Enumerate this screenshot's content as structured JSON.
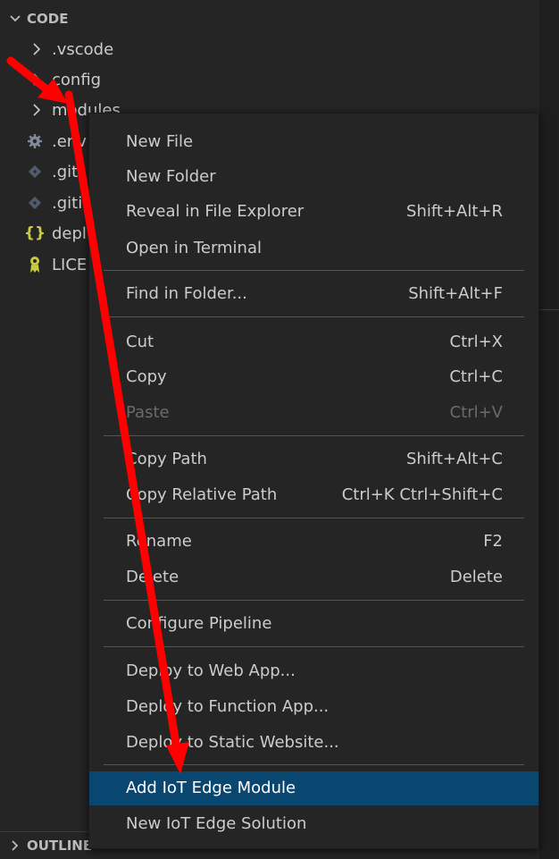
{
  "explorer": {
    "section_title": "CODE",
    "items": [
      {
        "label": ".vscode",
        "icon": "chevron-right-icon"
      },
      {
        "label": "config",
        "icon": "chevron-right-icon"
      },
      {
        "label": "modules",
        "icon": "chevron-right-icon"
      },
      {
        "label": ".env",
        "icon": "gear-icon"
      },
      {
        "label": ".giti",
        "icon": "git-icon"
      },
      {
        "label": ".giti",
        "icon": "git-icon"
      },
      {
        "label": "depl",
        "icon": "json-braces-icon"
      },
      {
        "label": "LICE",
        "icon": "license-icon"
      }
    ],
    "outline_title": "OUTLINE"
  },
  "context_menu": {
    "groups": [
      [
        {
          "label": "New File",
          "shortcut": ""
        },
        {
          "label": "New Folder",
          "shortcut": ""
        },
        {
          "label": "Reveal in File Explorer",
          "shortcut": "Shift+Alt+R"
        },
        {
          "label": "Open in Terminal",
          "shortcut": ""
        }
      ],
      [
        {
          "label": "Find in Folder...",
          "shortcut": "Shift+Alt+F"
        }
      ],
      [
        {
          "label": "Cut",
          "shortcut": "Ctrl+X"
        },
        {
          "label": "Copy",
          "shortcut": "Ctrl+C"
        },
        {
          "label": "Paste",
          "shortcut": "Ctrl+V",
          "disabled": true
        }
      ],
      [
        {
          "label": "Copy Path",
          "shortcut": "Shift+Alt+C"
        },
        {
          "label": "Copy Relative Path",
          "shortcut": "Ctrl+K Ctrl+Shift+C"
        }
      ],
      [
        {
          "label": "Rename",
          "shortcut": "F2"
        },
        {
          "label": "Delete",
          "shortcut": "Delete"
        }
      ],
      [
        {
          "label": "Configure Pipeline",
          "shortcut": ""
        }
      ],
      [
        {
          "label": "Deploy to Web App...",
          "shortcut": ""
        },
        {
          "label": "Deploy to Function App...",
          "shortcut": ""
        },
        {
          "label": "Deploy to Static Website...",
          "shortcut": ""
        }
      ],
      [
        {
          "label": "Add IoT Edge Module",
          "shortcut": "",
          "selected": true
        },
        {
          "label": "New IoT Edge Solution",
          "shortcut": ""
        }
      ]
    ]
  },
  "colors": {
    "sidebar_bg": "#252526",
    "menu_selected_bg": "#094771",
    "annotation_arrow": "#ff0000"
  }
}
